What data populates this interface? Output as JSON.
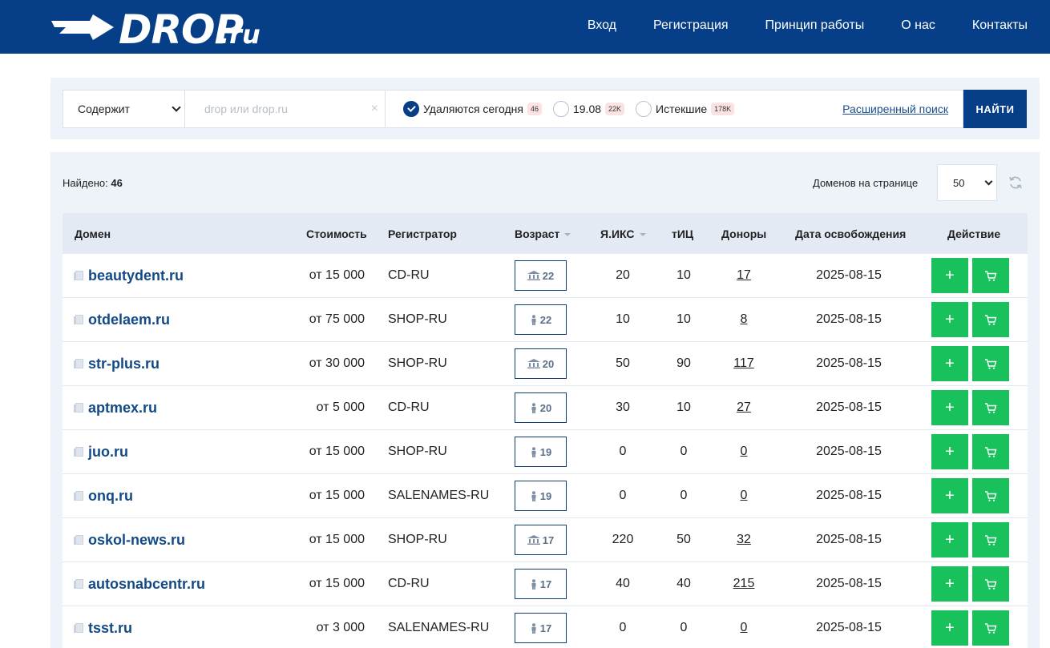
{
  "header": {
    "logo_main": "DROP",
    "logo_sub": ".ru",
    "nav": [
      "Вход",
      "Регистрация",
      "Принцип работы",
      "О нас",
      "Контакты"
    ]
  },
  "search": {
    "mode_value": "Содержит",
    "placeholder": "drop или drop.ru",
    "clear_icon": "×",
    "filters": [
      {
        "label": "Удаляются сегодня",
        "badge": "46",
        "checked": true
      },
      {
        "label": "19.08",
        "badge": "22K",
        "checked": false
      },
      {
        "label": "Истекшие",
        "badge": "178K",
        "checked": false
      }
    ],
    "advanced_label": "Расширенный поиск",
    "find_label": "НАЙТИ"
  },
  "results": {
    "found_label": "Найдено:",
    "found_count": "46",
    "per_page_label": "Доменов на странице",
    "per_page_value": "50"
  },
  "table": {
    "headers": {
      "domain": "Домен",
      "cost": "Стоимость",
      "registrar": "Регистратор",
      "age": "Возраст",
      "iks": "Я.ИКС",
      "tic": "тИЦ",
      "donors": "Доноры",
      "release": "Дата освобождения",
      "action": "Действие"
    },
    "rows": [
      {
        "domain": "beautydent.ru",
        "cost": "от 15 000",
        "registrar": "CD-RU",
        "age": "22",
        "age_icon": "bank-icon",
        "iks": "20",
        "tic": "10",
        "donors": "17",
        "release": "2025-08-15"
      },
      {
        "domain": "otdelaem.ru",
        "cost": "от 75 000",
        "registrar": "SHOP-RU",
        "age": "22",
        "age_icon": "person-icon",
        "iks": "10",
        "tic": "10",
        "donors": "8",
        "release": "2025-08-15"
      },
      {
        "domain": "str-plus.ru",
        "cost": "от 30 000",
        "registrar": "SHOP-RU",
        "age": "20",
        "age_icon": "bank-icon",
        "iks": "50",
        "tic": "90",
        "donors": "117",
        "release": "2025-08-15"
      },
      {
        "domain": "aptmex.ru",
        "cost": "от 5 000",
        "registrar": "CD-RU",
        "age": "20",
        "age_icon": "person-icon",
        "iks": "30",
        "tic": "10",
        "donors": "27",
        "release": "2025-08-15"
      },
      {
        "domain": "juo.ru",
        "cost": "от 15 000",
        "registrar": "SHOP-RU",
        "age": "19",
        "age_icon": "person-icon",
        "iks": "0",
        "tic": "0",
        "donors": "0",
        "release": "2025-08-15"
      },
      {
        "domain": "onq.ru",
        "cost": "от 15 000",
        "registrar": "SALENAMES-RU",
        "age": "19",
        "age_icon": "person-icon",
        "iks": "0",
        "tic": "0",
        "donors": "0",
        "release": "2025-08-15"
      },
      {
        "domain": "oskol-news.ru",
        "cost": "от 15 000",
        "registrar": "SHOP-RU",
        "age": "17",
        "age_icon": "bank-icon",
        "iks": "220",
        "tic": "50",
        "donors": "32",
        "release": "2025-08-15"
      },
      {
        "domain": "autosnabcentr.ru",
        "cost": "от 15 000",
        "registrar": "CD-RU",
        "age": "17",
        "age_icon": "person-icon",
        "iks": "40",
        "tic": "40",
        "donors": "215",
        "release": "2025-08-15"
      },
      {
        "domain": "tsst.ru",
        "cost": "от 3 000",
        "registrar": "SALENAMES-RU",
        "age": "17",
        "age_icon": "person-icon",
        "iks": "0",
        "tic": "0",
        "donors": "0",
        "release": "2025-08-15"
      }
    ],
    "add_label": "+"
  },
  "colors": {
    "brand": "#063f87",
    "action_green": "#19c15d",
    "panel_bg": "#eef3fa",
    "badge_bg": "#fbe3e3"
  }
}
